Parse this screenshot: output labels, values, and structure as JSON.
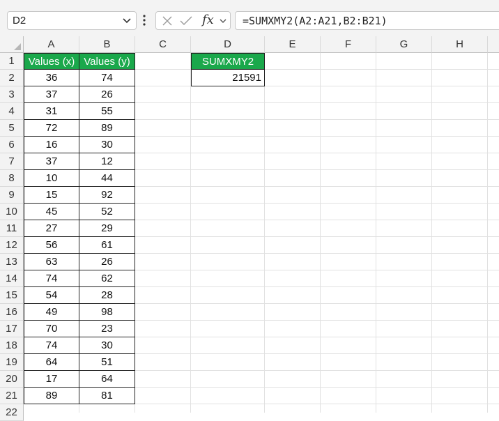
{
  "name_box": {
    "value": "D2"
  },
  "formula_bar": {
    "formula": "=SUMXMY2(A2:A21,B2:B21)",
    "fx_label": "fx"
  },
  "columns": [
    "A",
    "B",
    "C",
    "D",
    "E",
    "F",
    "G",
    "H"
  ],
  "rows": [
    "1",
    "2",
    "3",
    "4",
    "5",
    "6",
    "7",
    "8",
    "9",
    "10",
    "11",
    "12",
    "13",
    "14",
    "15",
    "16",
    "17",
    "18",
    "19",
    "20",
    "21",
    "22"
  ],
  "table": {
    "header_x": "Values (x)",
    "header_y": "Values (y)",
    "x": [
      "36",
      "37",
      "31",
      "72",
      "16",
      "37",
      "10",
      "15",
      "45",
      "27",
      "56",
      "63",
      "74",
      "54",
      "49",
      "70",
      "74",
      "64",
      "17",
      "89"
    ],
    "y": [
      "74",
      "26",
      "55",
      "89",
      "30",
      "12",
      "44",
      "92",
      "52",
      "29",
      "61",
      "26",
      "62",
      "28",
      "98",
      "23",
      "30",
      "51",
      "64",
      "81"
    ]
  },
  "result": {
    "header": "SUMXMY2",
    "value": "21591"
  },
  "colors": {
    "header_green": "#1aa84b",
    "header_text": "#ffffff"
  }
}
